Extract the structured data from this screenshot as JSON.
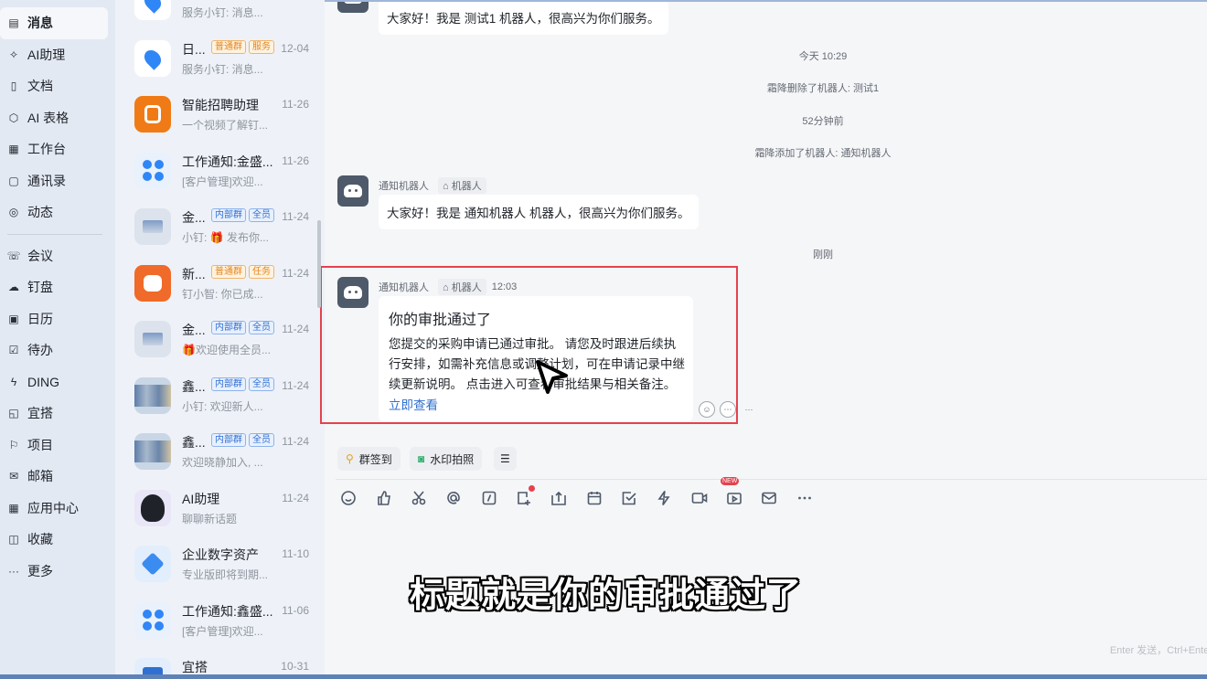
{
  "nav": {
    "items": [
      {
        "label": "消息",
        "icon": "message-icon",
        "glyph": "▤",
        "active": true
      },
      {
        "label": "AI助理",
        "icon": "ai-assistant-icon",
        "glyph": "✧"
      },
      {
        "label": "文档",
        "icon": "document-icon",
        "glyph": "▯"
      },
      {
        "label": "AI 表格",
        "icon": "ai-table-icon",
        "glyph": "⬡"
      },
      {
        "label": "工作台",
        "icon": "workbench-icon",
        "glyph": "▦"
      },
      {
        "label": "通讯录",
        "icon": "contacts-icon",
        "glyph": "▢"
      },
      {
        "label": "动态",
        "icon": "feed-icon",
        "glyph": "◎"
      },
      {
        "label": "会议",
        "icon": "meeting-icon",
        "glyph": "☏"
      },
      {
        "label": "钉盘",
        "icon": "drive-icon",
        "glyph": "☁"
      },
      {
        "label": "日历",
        "icon": "calendar-icon",
        "glyph": "▣"
      },
      {
        "label": "待办",
        "icon": "todo-icon",
        "glyph": "☑"
      },
      {
        "label": "DING",
        "icon": "ding-icon",
        "glyph": "ϟ"
      },
      {
        "label": "宜搭",
        "icon": "yida-icon",
        "glyph": "◱"
      },
      {
        "label": "项目",
        "icon": "project-icon",
        "glyph": "⚐"
      },
      {
        "label": "邮箱",
        "icon": "mail-icon",
        "glyph": "✉"
      },
      {
        "label": "应用中心",
        "icon": "app-center-icon",
        "glyph": "▦"
      },
      {
        "label": "收藏",
        "icon": "favorites-icon",
        "glyph": "◫"
      },
      {
        "label": "更多",
        "icon": "more-icon",
        "glyph": "···"
      }
    ]
  },
  "conversations": [
    {
      "name": "",
      "preview": "服务小钉: 消息...",
      "date": "",
      "avatar": "pin-icon",
      "tags": []
    },
    {
      "name": "日...",
      "preview": "服务小钉: 消息...",
      "date": "12-04",
      "avatar": "pin-icon",
      "tags": [
        {
          "text": "普通群",
          "color": "orange"
        },
        {
          "text": "服务",
          "color": "orange"
        }
      ]
    },
    {
      "name": "智能招聘助理",
      "preview": "一个视频了解钉...",
      "date": "11-26",
      "avatar": "recruit-icon",
      "tags": []
    },
    {
      "name": "工作通知:金盛...",
      "preview": "[客户管理]欢迎...",
      "date": "11-26",
      "avatar": "work-notice-icon",
      "tags": []
    },
    {
      "name": "金...",
      "preview": "小钉: 🎁 发布你...",
      "date": "11-24",
      "avatar": "group-image-icon",
      "tags": [
        {
          "text": "内部群",
          "color": "blue"
        },
        {
          "text": "全员",
          "color": "blue"
        }
      ]
    },
    {
      "name": "新...",
      "preview": "钉小智: 你已成...",
      "date": "11-24",
      "avatar": "task-bot-icon",
      "tags": [
        {
          "text": "普通群",
          "color": "orange"
        },
        {
          "text": "任务",
          "color": "orange"
        }
      ]
    },
    {
      "name": "金...",
      "preview": "🎁欢迎使用全员...",
      "date": "11-24",
      "avatar": "group-image-icon",
      "tags": [
        {
          "text": "内部群",
          "color": "blue"
        },
        {
          "text": "全员",
          "color": "blue"
        }
      ]
    },
    {
      "name": "鑫...",
      "preview": "小钉: 欢迎新人...",
      "date": "11-24",
      "avatar": "group-photo-icon",
      "tags": [
        {
          "text": "内部群",
          "color": "blue"
        },
        {
          "text": "全员",
          "color": "blue"
        }
      ]
    },
    {
      "name": "鑫...",
      "preview": "欢迎晓静加入, ...",
      "date": "11-24",
      "avatar": "group-photo-icon",
      "tags": [
        {
          "text": "内部群",
          "color": "blue"
        },
        {
          "text": "全员",
          "color": "blue"
        }
      ]
    },
    {
      "name": "AI助理",
      "preview": "聊聊新话题",
      "date": "11-24",
      "avatar": "ai-assistant-avatar-icon",
      "tags": []
    },
    {
      "name": "企业数字资产",
      "preview": "专业版即将到期...",
      "date": "11-10",
      "avatar": "diamond-icon",
      "tags": []
    },
    {
      "name": "工作通知:鑫盛...",
      "preview": "[客户管理]欢迎...",
      "date": "11-06",
      "avatar": "work-notice-icon",
      "tags": []
    },
    {
      "name": "宜搭",
      "preview": "",
      "date": "10-31",
      "avatar": "yida-app-icon",
      "tags": []
    }
  ],
  "chat": {
    "msg1": {
      "text": "大家好！我是 测试1 机器人，很高兴为你们服务。"
    },
    "sys1": "今天 10:29",
    "sys2": "霜降删除了机器人: 测试1",
    "sys3": "52分钟前",
    "sys4": "霜降添加了机器人: 通知机器人",
    "msg2": {
      "sender": "通知机器人",
      "tag": "机器人",
      "text": "大家好！我是 通知机器人 机器人，很高兴为你们服务。"
    },
    "sys5": "刚刚",
    "msg3": {
      "sender": "通知机器人",
      "tag": "机器人",
      "time": "12:03",
      "card_title": "你的审批通过了",
      "card_body": "您提交的采购申请已通过审批。 请您及时跟进后续执行安排，如需补充信息或调整计划，可在申请记录中继续更新说明。 点击进入可查看审批结果与相关备注。",
      "card_link": "立即查看"
    },
    "quick": {
      "checkin": "群签到",
      "watermark": "水印拍照"
    },
    "input_hint": "Enter 发送，Ctrl+Enter"
  },
  "subtitle": "标题就是你的审批通过了",
  "colors": {
    "accent": "#2f6fd1",
    "highlight": "#e5424d"
  }
}
